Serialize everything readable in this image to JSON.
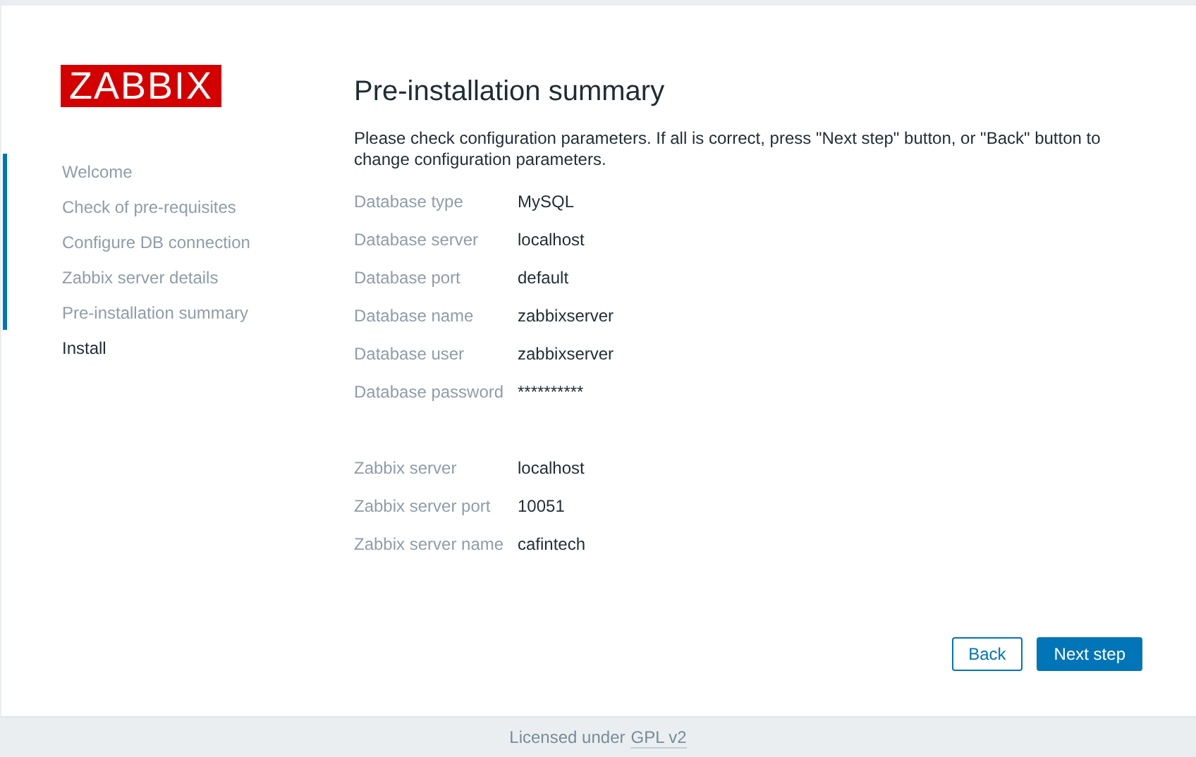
{
  "logo": "ZABBIX",
  "steps": [
    {
      "label": "Welcome",
      "done": true
    },
    {
      "label": "Check of pre-requisites",
      "done": true
    },
    {
      "label": "Configure DB connection",
      "done": true
    },
    {
      "label": "Zabbix server details",
      "done": true
    },
    {
      "label": "Pre-installation summary",
      "done": true
    },
    {
      "label": "Install",
      "done": false
    }
  ],
  "title": "Pre-installation summary",
  "description": "Please check configuration parameters. If all is correct, press \"Next step\" button, or \"Back\" button to change configuration parameters.",
  "groups": [
    [
      {
        "label": "Database type",
        "value": "MySQL"
      },
      {
        "label": "Database server",
        "value": "localhost"
      },
      {
        "label": "Database port",
        "value": "default"
      },
      {
        "label": "Database name",
        "value": "zabbixserver"
      },
      {
        "label": "Database user",
        "value": "zabbixserver"
      },
      {
        "label": "Database password",
        "value": "**********"
      }
    ],
    [
      {
        "label": "Zabbix server",
        "value": "localhost"
      },
      {
        "label": "Zabbix server port",
        "value": "10051"
      },
      {
        "label": "Zabbix server name",
        "value": "cafintech"
      }
    ]
  ],
  "buttons": [
    {
      "label": "Back",
      "kind": "secondary"
    },
    {
      "label": "Next step",
      "kind": "primary"
    }
  ],
  "footer": {
    "text": "Licensed under",
    "link": "GPL v2"
  }
}
